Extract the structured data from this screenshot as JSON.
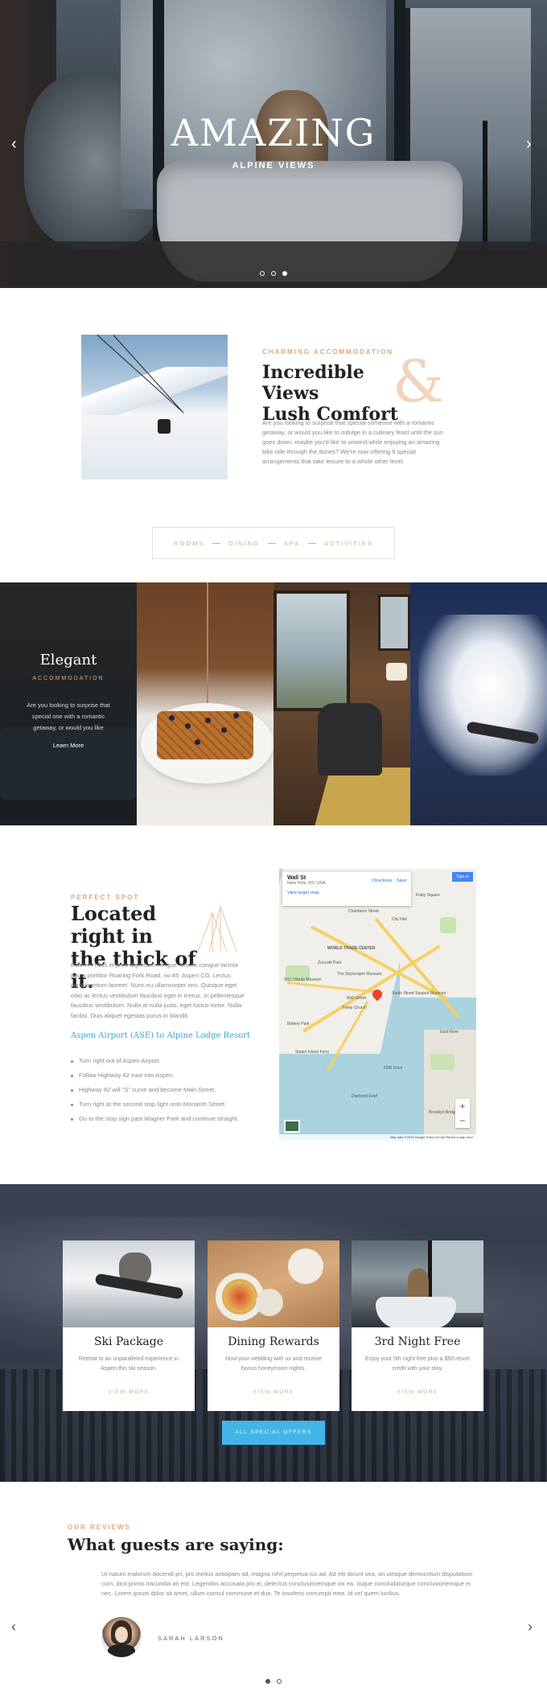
{
  "hero": {
    "title": "AMAZING",
    "subtitle": "ALPINE VIEWS",
    "prev_arrow": "‹",
    "next_arrow": "›",
    "slides_count": 3,
    "active_slide": 3
  },
  "intro": {
    "eyebrow": "CHARMING ACCOMMODATION",
    "title_line1": "Incredible Views",
    "title_line2": "Lush Comfort",
    "ampersand": "&",
    "text": "Are you looking to surprise that special someone with a romantic getaway, or would you like to indulge in a culinary feast until the sun goes down, maybe you'd like to unwind while enjoying an amazing bike ride through the dunes? We're now offering 9 special arrangements that take leisure to a whole other level."
  },
  "tabs": [
    "ROOMS",
    "DINING",
    "SPA",
    "ACTIVITIES"
  ],
  "feature": {
    "title": "Elegant",
    "eyebrow": "ACCOMMODATION",
    "text": "Are you looking to surprise that special one with a romantic getaway, or would you like",
    "link": "Learn More"
  },
  "location": {
    "eyebrow": "PERFECT SPOT",
    "title_line1": "Located right in",
    "title_line2": "the thick of it.",
    "text": "Etiam et risus et justo dignissim congue. Donec congue lacinia dui, a porttitor Roaring Fork Road, no:45, Aspen CO. Lectus condimentum laoreet. Nunc eu ullamcorper orci. Quisque eget odio ac lectus vestibulum faucibus eget in metus. In pellentesque faucibus vestibulum. Nulla at nulla justo, eget luctus tortor. Nulla facilisi. Duis aliquet egestas purus in blandit.",
    "link": "Aspen Airport (ASE) to Alpine Lodge Resort",
    "directions": [
      "Turn right out of Aspen Airport.",
      "Follow Highway 82 east into Aspen.",
      "Highway 82 will \"S\" curve and become Main Street.",
      "Turn right at the second stop light onto Monarch Street.",
      "Go to the stop sign past Wagner Park and continue straight."
    ]
  },
  "map": {
    "place": "Wall St",
    "place_sub": "New York, NY, USA",
    "larger_map": "View larger map",
    "directions": "Directions",
    "save": "Save",
    "sign_in": "Sign in",
    "zoom_in": "+",
    "zoom_out": "−",
    "footer": "Map data ©2019 Google   Terms of Use   Report a map error",
    "labels": {
      "district": "WORLD TRADE CENTER",
      "museum": "The Skyscraper Museum",
      "street": "Wall Street",
      "seaport": "South Street Seaport Museum",
      "hall": "City Hall",
      "chambers": "Chambers Street",
      "nine11": "9/11 Tribute Museum",
      "park": "Battery Park",
      "ferry": "Staten Island Ferry",
      "river": "East River",
      "reef": "Diamond Reef",
      "square": "Foley Square",
      "brooklyn": "Brooklyn Bridge Park",
      "fdr": "FDR Drive",
      "trinity": "Trinity Church",
      "zuccotti": "Zuccotti Park"
    }
  },
  "offers": {
    "cards": [
      {
        "title": "Ski Package",
        "text": "Retreat to an unparalleled experience in Aspen this ski season.",
        "link": "VIEW MORE"
      },
      {
        "title": "Dining Rewards",
        "text": "Host your wedding with us and receive bonus honeymoon nights.",
        "link": "VIEW MORE"
      },
      {
        "title": "3rd Night Free",
        "text": "Enjoy your 5th night free plus a $50 resort credit with your stay.",
        "link": "VIEW MORE"
      }
    ],
    "button": "ALL SPECIAL OFFERS"
  },
  "reviews": {
    "eyebrow": "OUR REVIEWS",
    "title": "What guests are saying:",
    "text": "Ut natum malorum docendi pri, pro melius antiopam ad, magna nihil perpetua ius ad. Ad elit dicunt sea, an utroque democritum disputationi cum, dicit primis iracundia an est. Legendos accusata pro ei, delectus conclusionemque vix ea. Iisque concludaturque conclusionemque ei nec. Lorem ipsum dolor sit amet, ullum consul commune et duo. Te insolens corrumpit mea. Id vel quem lucilius.",
    "name": "SARAH LARSON",
    "prev_arrow": "‹",
    "next_arrow": "›",
    "slides_count": 2,
    "active_slide": 1
  },
  "colors": {
    "accent": "#e0a77a",
    "link": "#3aa7d6",
    "button": "#42b5e8"
  }
}
